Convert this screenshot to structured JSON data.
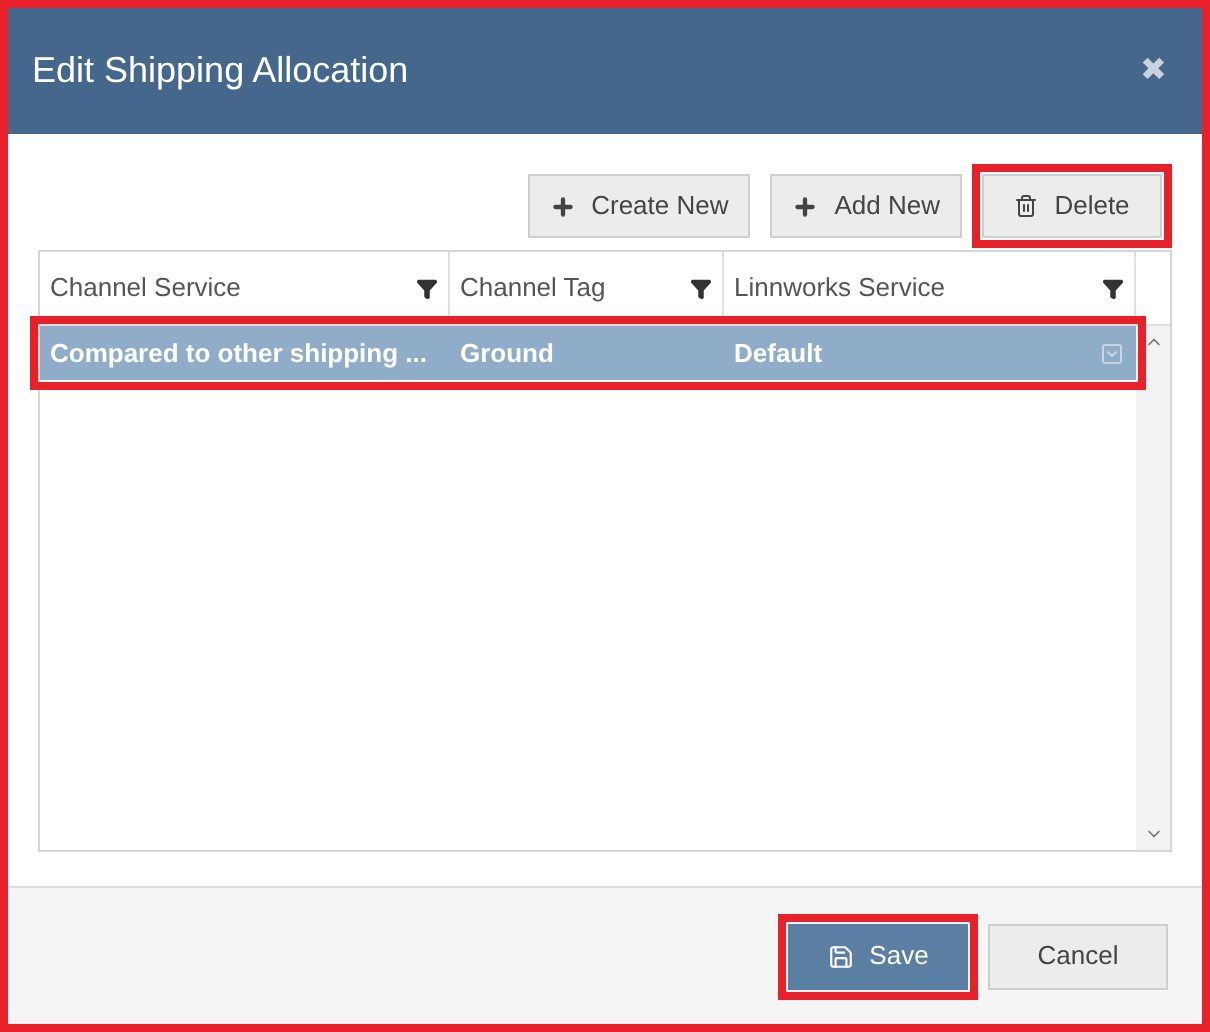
{
  "dialog": {
    "title": "Edit Shipping Allocation",
    "close": "✖",
    "highlighted": true
  },
  "toolbar": [
    {
      "kind": "plus",
      "label": "Create New",
      "highlighted": false
    },
    {
      "kind": "plus",
      "label": "Add New",
      "highlighted": false
    },
    {
      "kind": "trash",
      "label": "Delete",
      "highlighted": true
    }
  ],
  "table": {
    "columns": [
      "Channel Service",
      "Channel Tag",
      "Linnworks Service"
    ],
    "rows": [
      {
        "cells": [
          "Compared to other shipping ...",
          "Ground",
          "Default"
        ],
        "selected": true,
        "highlighted": true
      }
    ]
  },
  "footer": [
    {
      "kind": "primary",
      "label": "Save",
      "highlighted": true
    },
    {
      "kind": "secondary",
      "label": "Cancel",
      "highlighted": false
    }
  ]
}
